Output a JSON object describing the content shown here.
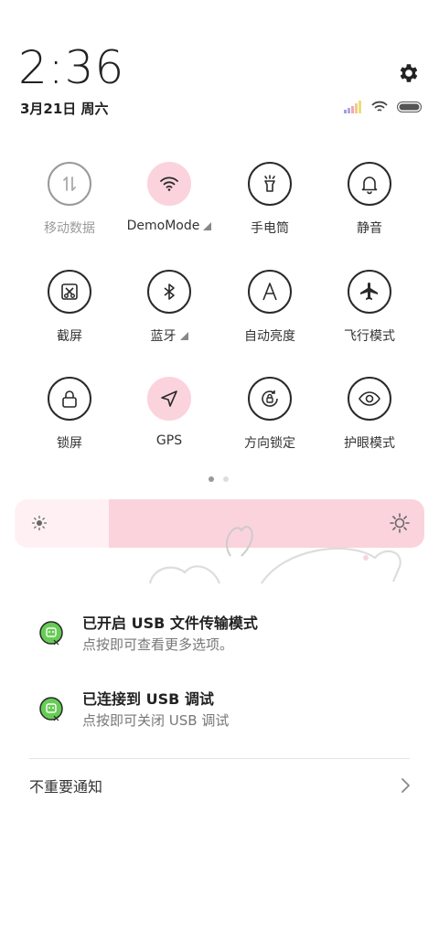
{
  "header": {
    "time": "2:36",
    "date": "3月21日 周六"
  },
  "status": {
    "signal_icon": "signal-bars-icon",
    "wifi_icon": "wifi-icon",
    "battery_icon": "battery-icon"
  },
  "quick_tiles": [
    {
      "label": "移动数据",
      "icon": "mobile-data-icon",
      "state": "disabled"
    },
    {
      "label": "DemoMode",
      "icon": "wifi-icon",
      "state": "active",
      "expand": true
    },
    {
      "label": "手电筒",
      "icon": "flashlight-icon",
      "state": "off"
    },
    {
      "label": "静音",
      "icon": "bell-icon",
      "state": "off"
    },
    {
      "label": "截屏",
      "icon": "screenshot-icon",
      "state": "off"
    },
    {
      "label": "蓝牙",
      "icon": "bluetooth-icon",
      "state": "off",
      "expand": true
    },
    {
      "label": "自动亮度",
      "icon": "auto-brightness-icon",
      "state": "off"
    },
    {
      "label": "飞行模式",
      "icon": "airplane-icon",
      "state": "off"
    },
    {
      "label": "锁屏",
      "icon": "lock-icon",
      "state": "off"
    },
    {
      "label": "GPS",
      "icon": "location-arrow-icon",
      "state": "active"
    },
    {
      "label": "方向锁定",
      "icon": "rotation-lock-icon",
      "state": "off"
    },
    {
      "label": "护眼模式",
      "icon": "eye-icon",
      "state": "off"
    }
  ],
  "pager": {
    "pages": 2,
    "current": 1
  },
  "brightness": {
    "level": 0.77
  },
  "notifications": [
    {
      "title": "已开启 USB 文件传输模式",
      "subtitle": "点按即可查看更多选项。",
      "icon": "android-debug-icon"
    },
    {
      "title": "已连接到 USB 调试",
      "subtitle": "点按即可关闭 USB 调试",
      "icon": "android-debug-icon"
    }
  ],
  "footer": {
    "label": "不重要通知"
  },
  "colors": {
    "accent": "#fbd3dc",
    "accent_light": "#fff1f3",
    "green": "#66cc55"
  }
}
